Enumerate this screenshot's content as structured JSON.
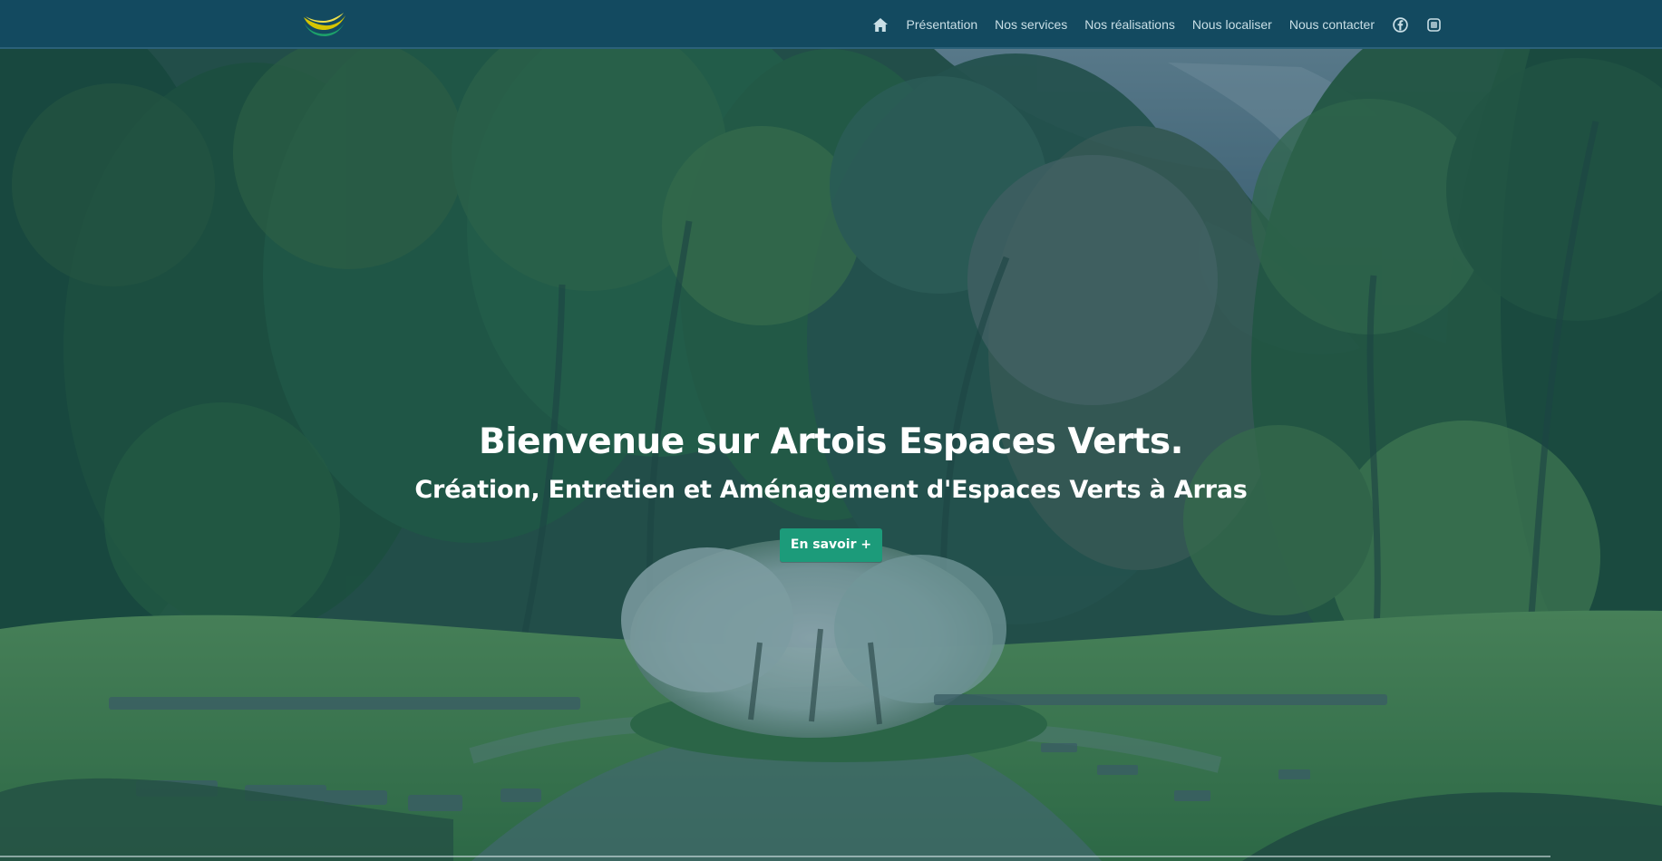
{
  "header": {
    "logo_colors": {
      "top": "#d6c500",
      "bottom": "#1da06a"
    },
    "home_icon": "home-icon",
    "nav": [
      {
        "label": "Présentation"
      },
      {
        "label": "Nos services"
      },
      {
        "label": "Nos réalisations"
      },
      {
        "label": "Nous localiser"
      },
      {
        "label": "Nous contacter"
      }
    ],
    "social": [
      {
        "icon": "facebook-icon"
      },
      {
        "icon": "instagram-icon"
      }
    ]
  },
  "hero": {
    "title": "Bienvenue sur Artois Espaces Verts.",
    "subtitle": "Création, Entretien et Aménagement d'Espaces Verts à Arras",
    "button_label": "En savoir +",
    "button_color": "#1c9b7a"
  },
  "theme": {
    "header_background": "#134a60",
    "overlay": "#144259",
    "nav_text": "#c9dfe6"
  }
}
